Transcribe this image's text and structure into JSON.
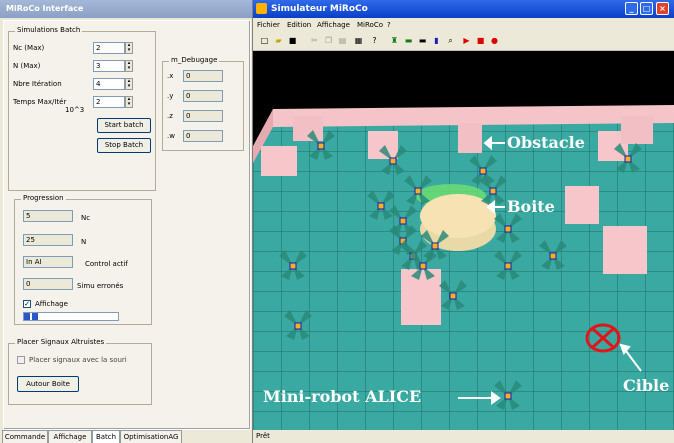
{
  "left_window": {
    "title": "MiRoCo Interface",
    "batch_group": {
      "label": "Simulations Batch",
      "fields": [
        {
          "label": "Nc (Max)",
          "value": "2"
        },
        {
          "label": "N (Max)",
          "value": "3"
        },
        {
          "label": "Nbre Itération",
          "value": "4"
        },
        {
          "label": "Temps Max/Itér",
          "value": "2"
        }
      ],
      "unit_label": "10^3",
      "start_button": "Start batch",
      "stop_button": "Stop Batch"
    },
    "debug_group": {
      "label": "m_Debugage",
      "fields": [
        {
          "label": ".x",
          "value": "0"
        },
        {
          "label": ".y",
          "value": "0"
        },
        {
          "label": ".z",
          "value": "0"
        },
        {
          "label": ".w",
          "value": "0"
        }
      ]
    },
    "progress_group": {
      "label": "Progression",
      "rows": [
        {
          "value": "5",
          "label": "Nc"
        },
        {
          "value": "25",
          "label": "N"
        },
        {
          "value": "In AI",
          "label": "Control actif"
        },
        {
          "value": "0",
          "label": "Simu erronés"
        }
      ],
      "checkbox_label": "Affichage",
      "progress_fraction": 0.15
    },
    "signals_group": {
      "label": "Placer Signaux Altruistes",
      "checkbox_label": "Placer signaux avec la souri",
      "button": "Autour Boite"
    },
    "tabs": [
      "Commande",
      "Affichage",
      "Batch",
      "OptimisationAG"
    ]
  },
  "right_window": {
    "title": "Simulateur MiRoCo",
    "menu": [
      "Fichier",
      "Edition",
      "Affichage",
      "MiRoCo",
      "?"
    ],
    "status": "Prêt",
    "annotations": {
      "obstacle": "Obstacle",
      "boite": "Boite",
      "cible": "Cible",
      "robot": "Mini-robot ALICE"
    }
  },
  "colors": {
    "floor": "#3aa9a2",
    "wall": "#f4c4c8",
    "box": "#f7e2b4",
    "target": "#e0161c"
  }
}
